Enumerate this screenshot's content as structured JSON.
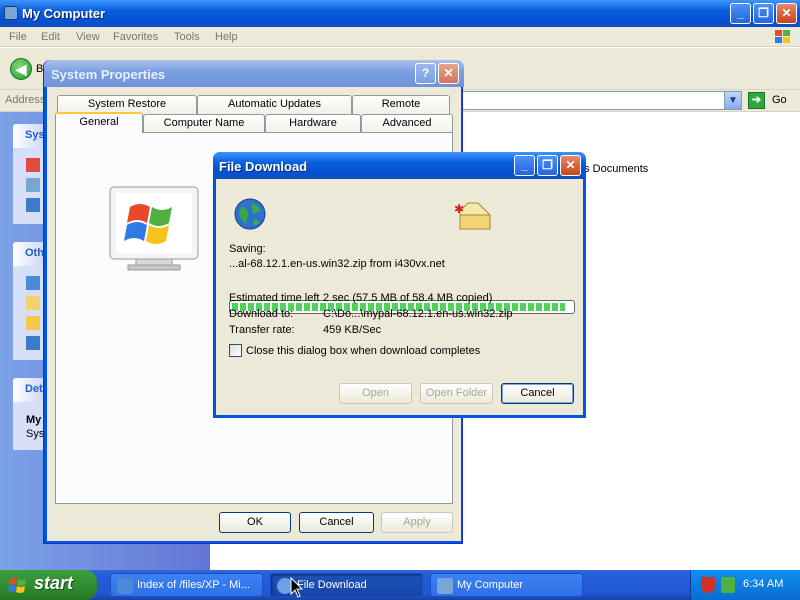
{
  "explorer": {
    "title": "My Computer",
    "menu": [
      "File",
      "Edit",
      "View",
      "Favorites",
      "Tools",
      "Help"
    ],
    "back_label": "B",
    "address_label": "Address",
    "go_label": "Go",
    "sidebar_headers": [
      "Sys",
      "Oth",
      "Det"
    ],
    "details_text": [
      "My",
      "Sys"
    ],
    "content_label": "'s Documents"
  },
  "system_properties": {
    "title": "System Properties",
    "tabs_row1": [
      "System Restore",
      "Automatic Updates",
      "Remote"
    ],
    "tabs_row2": [
      "General",
      "Computer Name",
      "Hardware",
      "Advanced"
    ],
    "active_tab": "General",
    "buttons": {
      "ok": "OK",
      "cancel": "Cancel",
      "apply": "Apply"
    }
  },
  "file_download": {
    "title": "File Download",
    "saving_label": "Saving:",
    "filename": "...al-68.12.1.en-us.win32.zip from i430vx.net",
    "progress_fraction": 0.98,
    "est_time_label": "Estimated time left",
    "est_time_value": "2 sec (57.5 MB of 58.4 MB copied)",
    "download_to_label": "Download to:",
    "download_to_value": "C:\\Do...\\mypal-68.12.1.en-us.win32.zip",
    "transfer_rate_label": "Transfer rate:",
    "transfer_rate_value": "459 KB/Sec",
    "close_checkbox_label": "Close this dialog box when download completes",
    "close_checkbox_checked": false,
    "buttons": {
      "open": "Open",
      "open_folder": "Open Folder",
      "cancel": "Cancel"
    }
  },
  "taskbar": {
    "start_label": "start",
    "tasks": [
      {
        "label": "Index of /files/XP - Mi...",
        "active": false
      },
      {
        "label": "File Download",
        "active": true
      },
      {
        "label": "My Computer",
        "active": false
      }
    ],
    "clock": "6:34 AM"
  },
  "colors": {
    "xp_blue_title": "#0a5fdc",
    "taskbar_blue": "#245edb",
    "start_green": "#2f8a2f",
    "progress_green": "#4fd35a",
    "dialog_face": "#ece9d8"
  }
}
